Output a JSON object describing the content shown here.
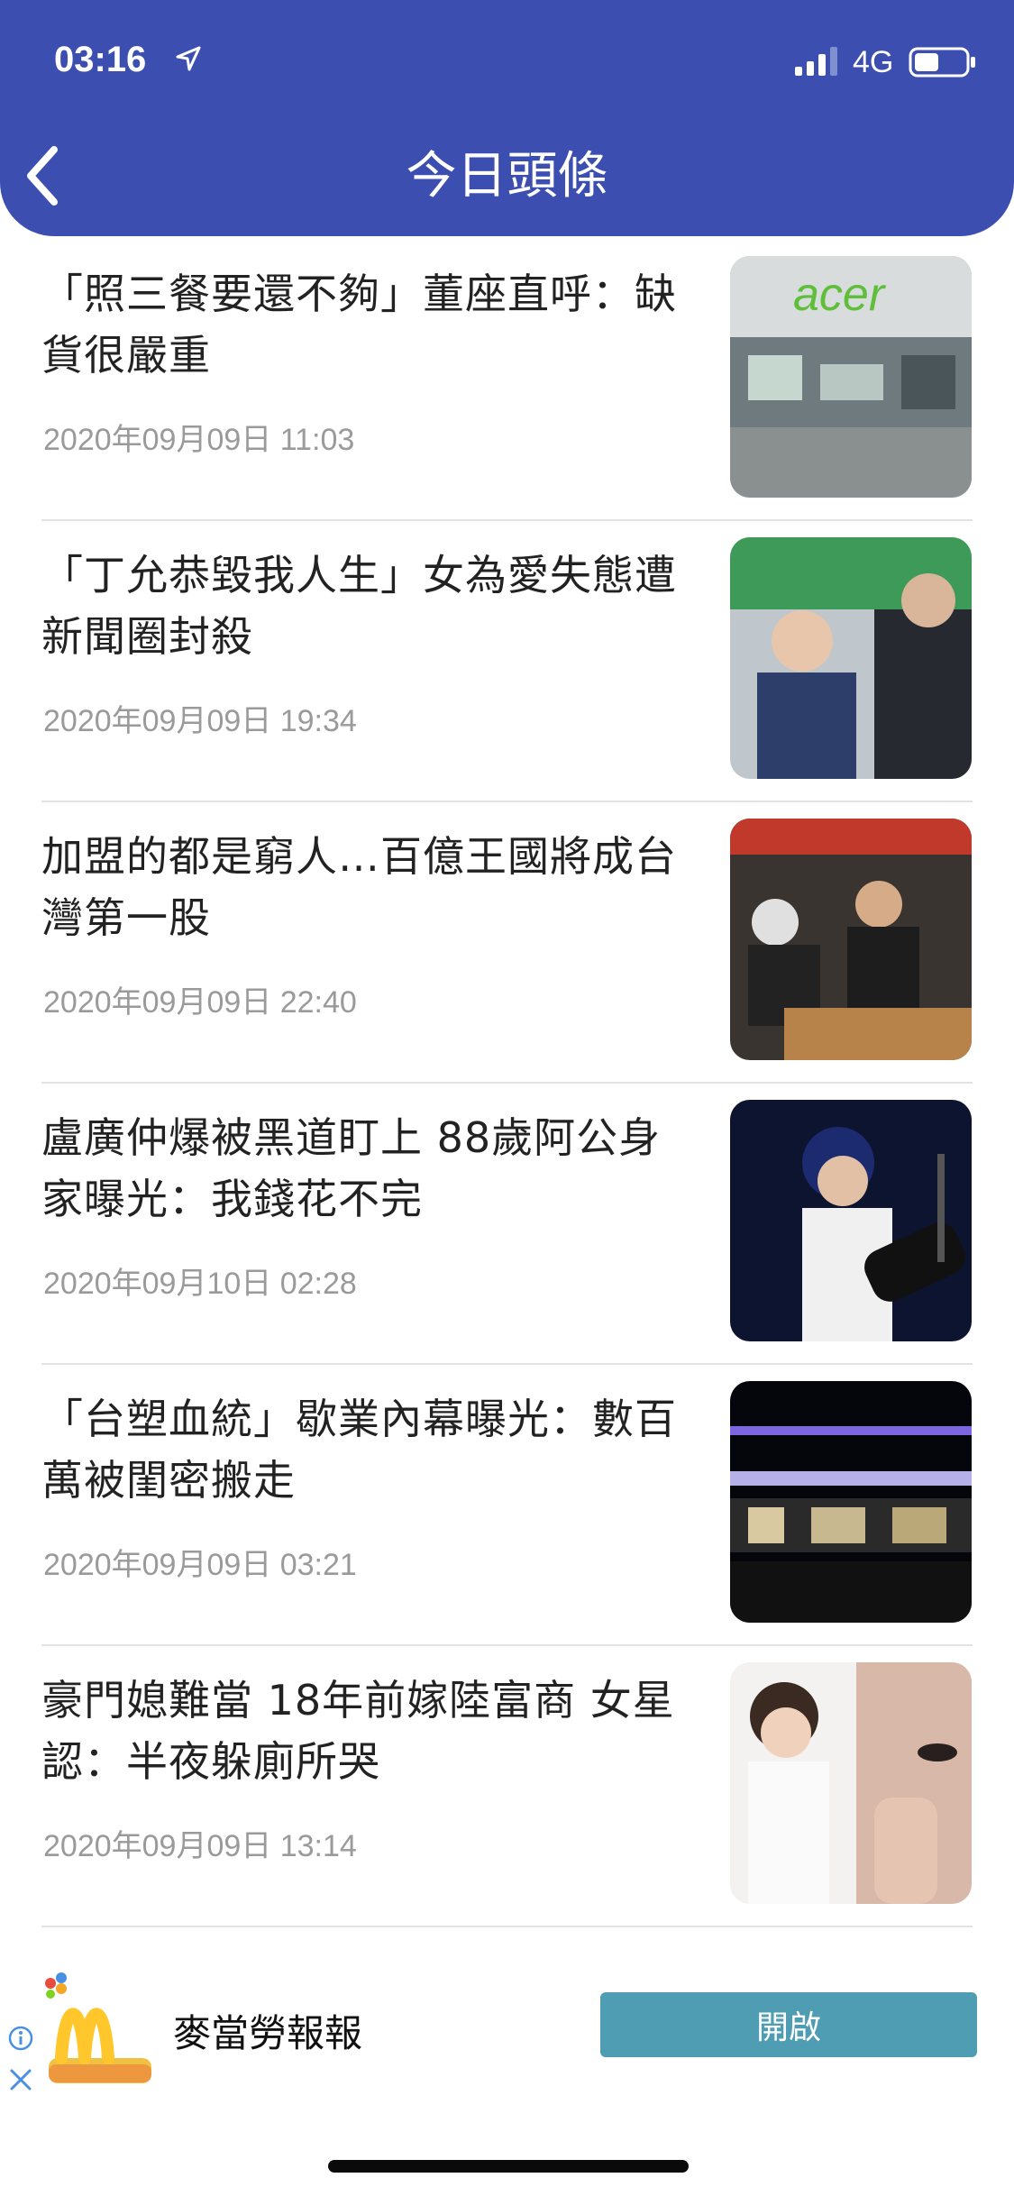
{
  "status_bar": {
    "time": "03:16",
    "network": "4G"
  },
  "nav": {
    "title": "今日頭條"
  },
  "news": [
    {
      "title": "「照三餐要還不夠」董座直呼：缺貨很嚴重",
      "date": "2020年09月09日 11:03",
      "thumb_desc": "acer-store-photo"
    },
    {
      "title": "「丁允恭毀我人生」女為愛失態遭新聞圈封殺",
      "date": "2020年09月09日 19:34",
      "thumb_desc": "president-event-photo"
    },
    {
      "title": "加盟的都是窮人…百億王國將成台灣第一股",
      "date": "2020年09月09日 22:40",
      "thumb_desc": "shop-counter-photo"
    },
    {
      "title": "盧廣仲爆被黑道盯上 88歲阿公身家曝光：我錢花不完",
      "date": "2020年09月10日 02:28",
      "thumb_desc": "singer-guitar-photo"
    },
    {
      "title": "「台塑血統」歇業內幕曝光：數百萬被閨密搬走",
      "date": "2020年09月09日 03:21",
      "thumb_desc": "building-night-photo"
    },
    {
      "title": "豪門媳難當 18年前嫁陸富商 女星認：半夜躲廁所哭",
      "date": "2020年09月09日 13:14",
      "thumb_desc": "woman-portrait-photo"
    }
  ],
  "ad": {
    "name": "麥當勞報報",
    "button": "開啟"
  },
  "colors": {
    "header": "#3c4fb1",
    "ad_button": "#4f9db3",
    "date_text": "#9a9a9a",
    "divider": "#e2e2e2"
  }
}
